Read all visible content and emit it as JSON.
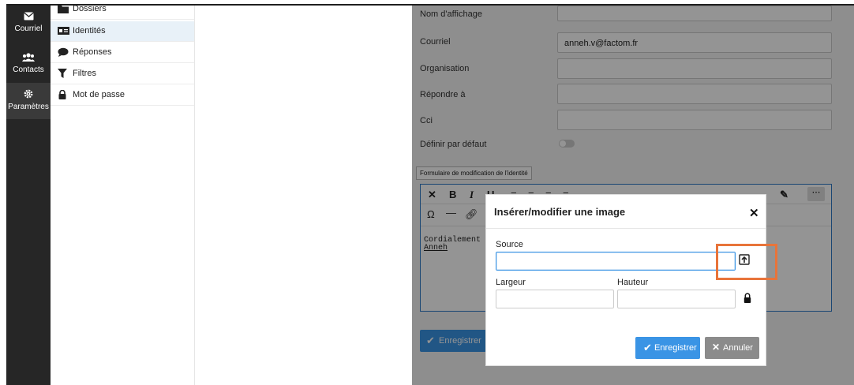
{
  "rail": {
    "items": [
      {
        "label": "Courriel",
        "icon": "envelope-icon"
      },
      {
        "label": "Contacts",
        "icon": "users-icon"
      },
      {
        "label": "Paramètres",
        "icon": "gear-icon"
      }
    ]
  },
  "settings": {
    "items": [
      {
        "label": "Dossiers",
        "icon": "folder-icon"
      },
      {
        "label": "Identités",
        "icon": "id-card-icon"
      },
      {
        "label": "Réponses",
        "icon": "comment-icon"
      },
      {
        "label": "Filtres",
        "icon": "filter-icon"
      },
      {
        "label": "Mot de passe",
        "icon": "lock-icon"
      }
    ],
    "active": "Identités"
  },
  "form": {
    "display_name_label": "Nom d'affichage",
    "display_name_value": "",
    "email_label": "Courriel",
    "email_value": "anneh.v@factom.fr",
    "organisation_label": "Organisation",
    "organisation_value": "",
    "reply_to_label": "Répondre à",
    "reply_to_value": "",
    "bcc_label": "Cci",
    "bcc_value": "",
    "default_label": "Définir par défaut",
    "default_on": false,
    "tooltip": "Formulaire de modification de l'identité",
    "signature_line1": "Cordialement",
    "signature_line2": "Anneh",
    "save_label": "Enregistrer"
  },
  "dialog": {
    "title": "Insérer/modifier une image",
    "source_label": "Source",
    "source_value": "",
    "width_label": "Largeur",
    "width_value": "",
    "height_label": "Hauteur",
    "height_value": "",
    "save_label": "Enregistrer",
    "cancel_label": "Annuler"
  },
  "colors": {
    "accent": "#3a94e5",
    "highlight": "#e8743a",
    "rail": "#262626"
  }
}
